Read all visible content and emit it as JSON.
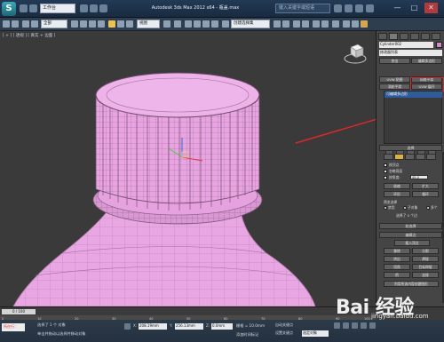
{
  "titlebar": {
    "app_logo": "S",
    "workspace": "工作台",
    "title": "Autodesk 3ds Max 2012 x64 - 瓶盖.max",
    "search_placeholder": "键入关键字或短语",
    "minimize": "—",
    "maximize": "□",
    "close": "✕"
  },
  "toolbar": {
    "selection_filter": "全部",
    "view_ref": "视图",
    "named_selection": "创建选择集"
  },
  "viewport": {
    "label": "[ + ] [ 透视 ] [ 真实 + 边面 ]"
  },
  "command_panel": {
    "object_name": "Cylinder002",
    "object_color": "#d985c9",
    "modifier_list": "修改器列表",
    "buttons": {
      "extrude": "挤出",
      "edit_poly": "编辑多边形",
      "uvw_map": "UVW 贴图",
      "mesh_smooth": "网格平滑",
      "uvw_xform": "UVW 展开",
      "turbo_smooth": "涡轮平滑"
    },
    "stack_item": "可编辑多边形",
    "rollout_selection": "选择",
    "sel_by_vertex": "按顶点",
    "ignore_backfacing": "忽略背面",
    "by_angle": "按角度:",
    "angle_value": "45.0",
    "shrink": "收缩",
    "grow": "扩大",
    "ring": "环形",
    "loop": "循环",
    "preview_selection": "预览选择",
    "preview_off": "禁用",
    "preview_subobj": "子对象",
    "preview_multi": "多个",
    "selection_status": "选择了 0 个边",
    "rollout_soft": "软选择",
    "rollout_edit_edges": "编辑边",
    "insert_vertex": "插入顶点",
    "remove": "移除",
    "split": "分割",
    "extrude_edges": "挤出",
    "weld": "焊接",
    "chamfer": "切角",
    "target_weld": "目标焊接",
    "bridge": "桥",
    "connect": "连接",
    "create_shape": "利用所选内容创建图形"
  },
  "timeline": {
    "slider": "0 / 100",
    "ticks": [
      "0",
      "10",
      "20",
      "30",
      "40",
      "50",
      "60",
      "70",
      "80",
      "90",
      "100"
    ]
  },
  "statusbar": {
    "mode": "所在行：",
    "line1": "选择了 1 个 对象",
    "line2": "单击并拖动以选择并移动对象",
    "x_label": "X:",
    "x_value": "208.19mm",
    "y_label": "Y:",
    "y_value": "256.13mm",
    "z_label": "Z:",
    "z_value": "0.0mm",
    "grid": "栅格 = 10.0mm",
    "add_time_tag": "添加时间标记",
    "auto_key": "自动关键点",
    "set_key": "设置关键点",
    "key_filter": "选定对象"
  },
  "watermark": {
    "text": "Bai 经验",
    "sub": "jingyan.baidu.com"
  }
}
